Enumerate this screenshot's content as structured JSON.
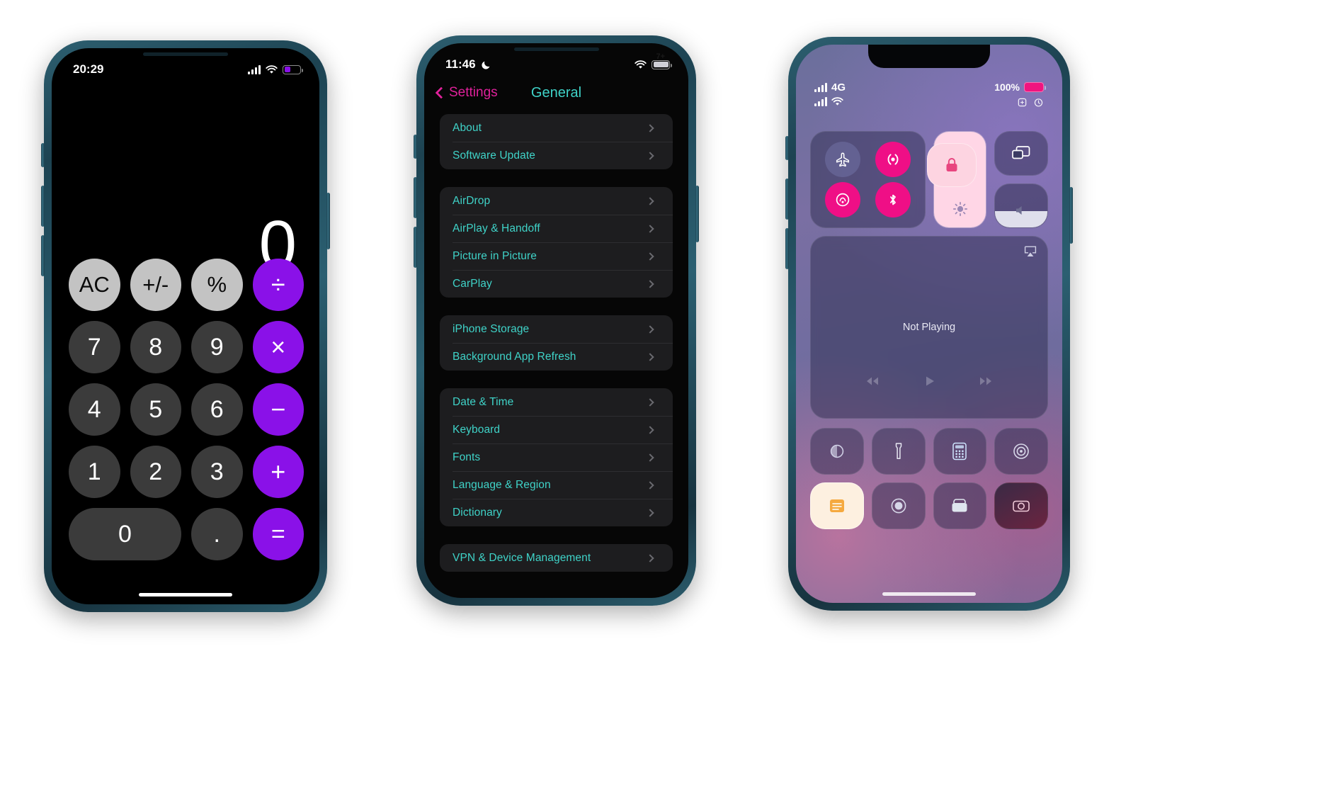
{
  "calculator": {
    "status": {
      "time": "20:29",
      "battery_color": "#8a11e8"
    },
    "display_value": "0",
    "keys": [
      {
        "label": "AC",
        "type": "fn",
        "name": "all-clear"
      },
      {
        "label": "+/-",
        "type": "fn",
        "name": "sign-toggle"
      },
      {
        "label": "%",
        "type": "fn",
        "name": "percent"
      },
      {
        "label": "÷",
        "type": "op",
        "name": "divide"
      },
      {
        "label": "7",
        "type": "num",
        "name": "seven"
      },
      {
        "label": "8",
        "type": "num",
        "name": "eight"
      },
      {
        "label": "9",
        "type": "num",
        "name": "nine"
      },
      {
        "label": "×",
        "type": "op",
        "name": "multiply"
      },
      {
        "label": "4",
        "type": "num",
        "name": "four"
      },
      {
        "label": "5",
        "type": "num",
        "name": "five"
      },
      {
        "label": "6",
        "type": "num",
        "name": "six"
      },
      {
        "label": "−",
        "type": "op",
        "name": "subtract"
      },
      {
        "label": "1",
        "type": "num",
        "name": "one"
      },
      {
        "label": "2",
        "type": "num",
        "name": "two"
      },
      {
        "label": "3",
        "type": "num",
        "name": "three"
      },
      {
        "label": "+",
        "type": "op",
        "name": "add"
      },
      {
        "label": "0",
        "type": "zero",
        "name": "zero"
      },
      {
        "label": ".",
        "type": "num",
        "name": "decimal"
      },
      {
        "label": "=",
        "type": "eq",
        "name": "equals"
      }
    ],
    "accent": "#8a11e8"
  },
  "settings": {
    "status": {
      "time": "11:46",
      "battery_label": "7+"
    },
    "nav": {
      "back_label": "Settings",
      "title": "General"
    },
    "accent_back": "#e0219b",
    "accent_title": "#3fd3c8",
    "groups": [
      {
        "items": [
          {
            "label": "About"
          },
          {
            "label": "Software Update"
          }
        ]
      },
      {
        "items": [
          {
            "label": "AirDrop"
          },
          {
            "label": "AirPlay & Handoff"
          },
          {
            "label": "Picture in Picture"
          },
          {
            "label": "CarPlay"
          }
        ]
      },
      {
        "items": [
          {
            "label": "iPhone Storage"
          },
          {
            "label": "Background App Refresh"
          }
        ]
      },
      {
        "items": [
          {
            "label": "Date & Time"
          },
          {
            "label": "Keyboard"
          },
          {
            "label": "Fonts"
          },
          {
            "label": "Language & Region"
          },
          {
            "label": "Dictionary"
          }
        ]
      },
      {
        "items": [
          {
            "label": "VPN & Device Management"
          }
        ]
      }
    ]
  },
  "control_center": {
    "status": {
      "network_label": "4G",
      "battery_percent": "100%",
      "battery_color": "#f0147f"
    },
    "connectivity": [
      {
        "name": "airplane-mode",
        "state": "off"
      },
      {
        "name": "cellular-data",
        "state": "on"
      },
      {
        "name": "airdrop",
        "state": "on"
      },
      {
        "name": "bluetooth",
        "state": "on"
      }
    ],
    "tiles": [
      {
        "name": "rotation-lock",
        "state": "on"
      },
      {
        "name": "screen-mirroring",
        "state": "off"
      },
      {
        "name": "brightness-slider",
        "level": 100
      },
      {
        "name": "volume-slider",
        "level": 38
      }
    ],
    "media": {
      "title": "Not Playing",
      "airplay": "airplay-icon",
      "controls": [
        "rewind",
        "play",
        "forward"
      ]
    },
    "apps": [
      {
        "name": "focus-moon"
      },
      {
        "name": "flashlight"
      },
      {
        "name": "calculator"
      },
      {
        "name": "timer"
      },
      {
        "name": "notes"
      },
      {
        "name": "screen-record"
      },
      {
        "name": "wallet"
      },
      {
        "name": "camera"
      }
    ]
  }
}
